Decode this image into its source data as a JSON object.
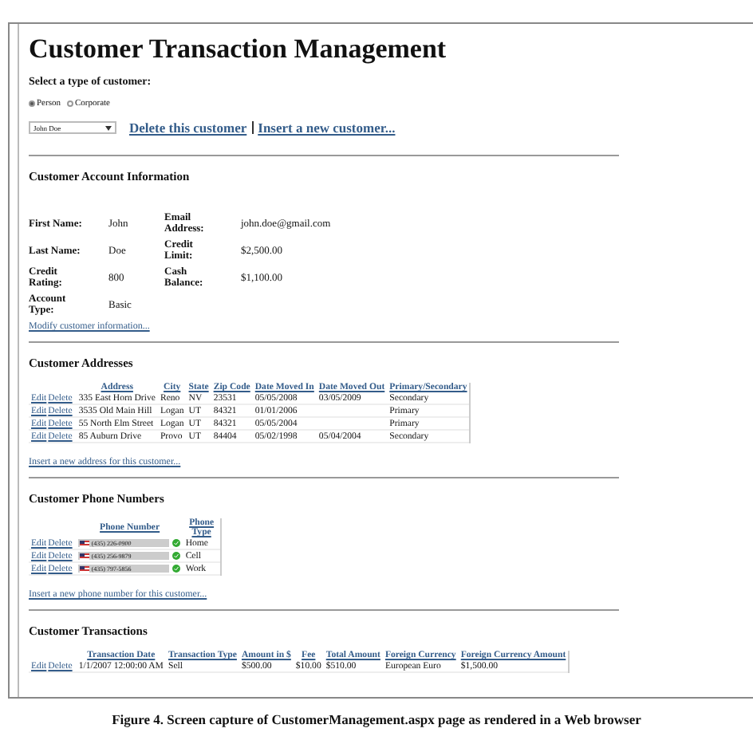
{
  "page": {
    "title": "Customer Transaction Management",
    "customer_type_prompt": "Select a type of customer:",
    "customer_types": [
      {
        "label": "Person",
        "selected": true
      },
      {
        "label": "Corporate",
        "selected": false
      }
    ],
    "customer_select": {
      "value": "John Doe"
    },
    "links": [
      "Delete this customer",
      "Insert a new customer..."
    ]
  },
  "account": {
    "heading": "Customer Account Information",
    "rows": [
      [
        {
          "label": "First Name:",
          "value": "John"
        },
        {
          "label": "Email Address:",
          "value": "john.doe@gmail.com"
        }
      ],
      [
        {
          "label": "Last Name:",
          "value": "Doe"
        },
        {
          "label": "Credit Limit:",
          "value": "$2,500.00"
        }
      ],
      [
        {
          "label": "Credit Rating:",
          "value": "800"
        },
        {
          "label": "Cash Balance:",
          "value": "$1,100.00"
        }
      ],
      [
        {
          "label": "Account Type:",
          "value": "Basic"
        }
      ]
    ],
    "link": "Modify customer information..."
  },
  "addresses": {
    "heading": "Customer Addresses",
    "columns": [
      "Address",
      "City",
      "State",
      "Zip Code",
      "Date Moved In",
      "Date Moved Out",
      "Primary/Secondary"
    ],
    "rows": [
      {
        "actions": [
          "Edit",
          "Delete"
        ],
        "cells": [
          "335 East Horn Drive",
          "Reno",
          "NV",
          "23531",
          "05/05/2008",
          "03/05/2009",
          "Secondary"
        ]
      },
      {
        "actions": [
          "Edit",
          "Delete"
        ],
        "cells": [
          "3535 Old Main Hill",
          "Logan",
          "UT",
          "84321",
          "01/01/2006",
          "",
          "Primary"
        ]
      },
      {
        "actions": [
          "Edit",
          "Delete"
        ],
        "cells": [
          "55 North Elm Street",
          "Logan",
          "UT",
          "84321",
          "05/05/2004",
          "",
          "Primary"
        ]
      },
      {
        "actions": [
          "Edit",
          "Delete"
        ],
        "cells": [
          "85 Auburn Drive",
          "Provo",
          "UT",
          "84404",
          "05/02/1998",
          "05/04/2004",
          "Secondary"
        ]
      }
    ],
    "link": "Insert a new address for this customer..."
  },
  "phones": {
    "heading": "Customer Phone Numbers",
    "columns": [
      "Phone Number",
      "Phone Type"
    ],
    "rows": [
      {
        "actions": [
          "Edit",
          "Delete"
        ],
        "number": "(435) 226-0900",
        "type": "Home"
      },
      {
        "actions": [
          "Edit",
          "Delete"
        ],
        "number": "(435) 256-9879",
        "type": "Cell"
      },
      {
        "actions": [
          "Edit",
          "Delete"
        ],
        "number": "(435) 797-5856",
        "type": "Work"
      }
    ],
    "link": "Insert a new phone number for this customer..."
  },
  "transactions": {
    "heading": "Customer Transactions",
    "columns": [
      "Transaction Date",
      "Transaction Type",
      "Amount in $",
      "Fee",
      "Total Amount",
      "Foreign Currency",
      "Foreign Currency Amount"
    ],
    "rows": [
      {
        "actions": [
          "Edit",
          "Delete"
        ],
        "cells": [
          "1/1/2007 12:00:00 AM",
          "Sell",
          "$500.00",
          "$10.00",
          "$510.00",
          "European Euro",
          "$1,500.00"
        ]
      }
    ]
  },
  "caption": "Figure 4.  Screen capture of CustomerManagement.aspx page as rendered in a Web browser"
}
